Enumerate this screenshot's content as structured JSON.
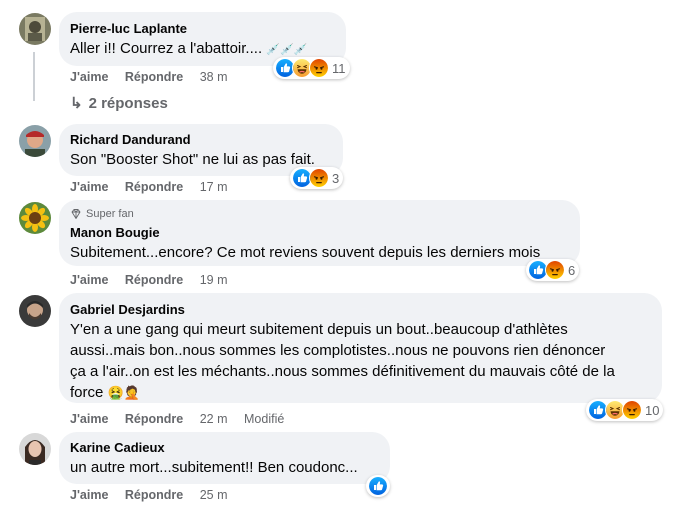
{
  "comments": [
    {
      "author": "Pierre-luc Laplante",
      "text": "Aller i!! Courrez a l'abattoir....",
      "text_emoji": "💉💉💉",
      "like_label": "J'aime",
      "reply_label": "Répondre",
      "time": "38 m",
      "reactions": [
        "like-icon",
        "haha-icon",
        "angry-icon"
      ],
      "reaction_count": "11",
      "replies_label": "2 réponses"
    },
    {
      "author": "Richard Dandurand",
      "text": "Son \"Booster Shot\" ne lui as pas fait.",
      "like_label": "J'aime",
      "reply_label": "Répondre",
      "time": "17 m",
      "reactions": [
        "like-icon",
        "angry-icon"
      ],
      "reaction_count": "3"
    },
    {
      "badge": "Super fan",
      "author": "Manon Bougie",
      "text": "Subitement...encore? Ce mot reviens souvent depuis les derniers mois",
      "like_label": "J'aime",
      "reply_label": "Répondre",
      "time": "19 m",
      "reactions": [
        "like-icon",
        "angry-icon"
      ],
      "reaction_count": "6"
    },
    {
      "author": "Gabriel Desjardins",
      "text_lines": [
        "Y'en a une gang qui meurt subitement depuis un bout..beaucoup d'athlètes",
        "aussi..mais bon..nous sommes les complotistes..nous ne pouvons rien dénoncer",
        "ça a l'air..on est les méchants..nous sommes définitivement du mauvais côté de la",
        "force"
      ],
      "text_emoji": "🤮🤦",
      "like_label": "J'aime",
      "reply_label": "Répondre",
      "time": "22 m",
      "edited_label": "Modifié",
      "reactions": [
        "like-icon",
        "haha-icon",
        "angry-icon"
      ],
      "reaction_count": "10"
    },
    {
      "author": "Karine Cadieux",
      "text": "un autre mort...subitement!! Ben coudonc...",
      "like_label": "J'aime",
      "reply_label": "Répondre",
      "time": "25 m",
      "reactions": [
        "like-icon"
      ],
      "reaction_count": ""
    }
  ],
  "colors": {
    "like": "#1877f2",
    "angry": "#e9710f",
    "haha": "#f7b125",
    "bubble": "#f0f2f5",
    "meta": "#65676b"
  }
}
